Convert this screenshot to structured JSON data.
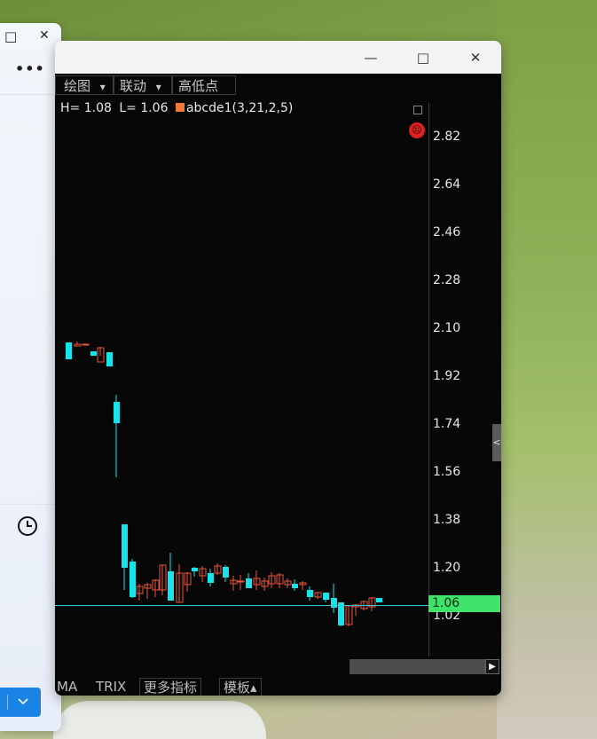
{
  "left_window": {
    "maximize_icon": "□",
    "close_icon": "✕",
    "more_icon": "•••",
    "clock_icon": "clock",
    "dropdown_icon": "chevron-down"
  },
  "window": {
    "minimize_icon": "—",
    "maximize_icon": "□",
    "close_icon": "✕"
  },
  "toolbar": {
    "draw_label": "绘图",
    "link_label": "联动",
    "highlow_label": "高低点",
    "dropdown_glyph": "▾"
  },
  "legend": {
    "high_text": "H= 1.08",
    "low_text": "L= 1.06",
    "indicator_text": "abcde1(3,21,2,5)",
    "indicator_color": "#f07a37"
  },
  "price_axis": {
    "labels": [
      "2.82",
      "2.64",
      "2.46",
      "2.28",
      "2.10",
      "1.92",
      "1.74",
      "1.56",
      "1.38",
      "1.20",
      "1.02"
    ],
    "current_price": "1.06",
    "current_price_color": "#3ee36a"
  },
  "side_tab_glyph": "<",
  "bottom_tabs": {
    "ma": "MA",
    "trix": "TRIX",
    "more_indicators": "更多指标",
    "template": "模板▴"
  },
  "scroll_arrow_glyph": "▶",
  "colors": {
    "up_candle": "#e8553a",
    "down_candle": "#16e3ea",
    "background": "#070707"
  }
}
